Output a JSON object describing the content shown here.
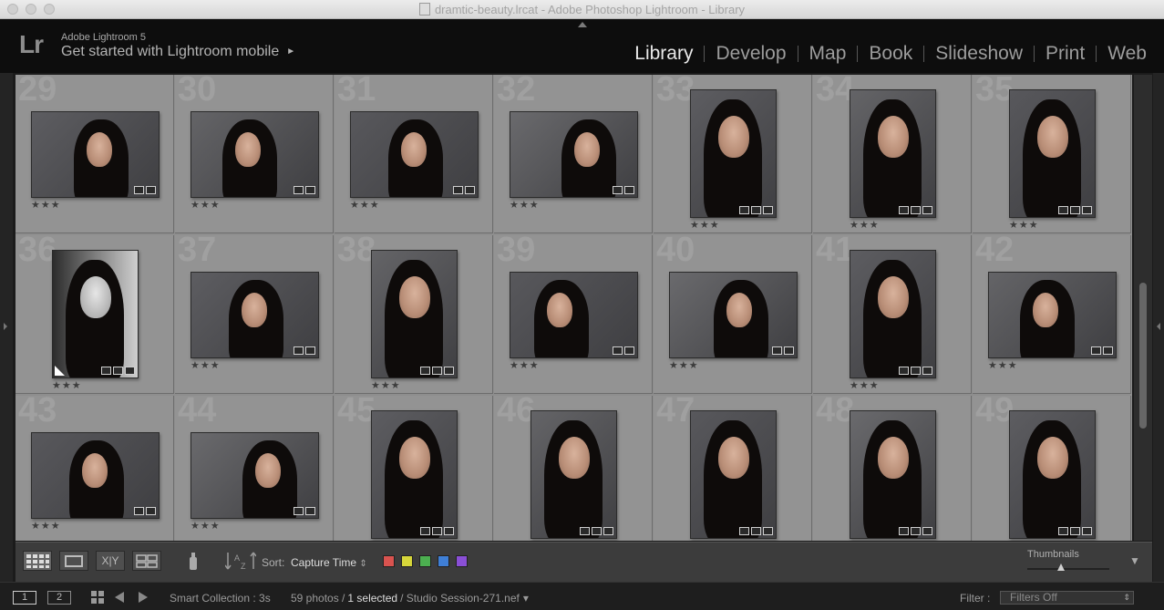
{
  "window": {
    "title": "dramtic-beauty.lrcat - Adobe Photoshop Lightroom - Library"
  },
  "identity": {
    "logo": "Lr",
    "version": "Adobe Lightroom 5",
    "mobile_prompt": "Get started with Lightroom mobile",
    "mobile_arrow": "►"
  },
  "modules": [
    {
      "label": "Library",
      "active": true
    },
    {
      "label": "Develop",
      "active": false
    },
    {
      "label": "Map",
      "active": false
    },
    {
      "label": "Book",
      "active": false
    },
    {
      "label": "Slideshow",
      "active": false
    },
    {
      "label": "Print",
      "active": false
    },
    {
      "label": "Web",
      "active": false
    }
  ],
  "grid": {
    "cells": [
      {
        "num": "29",
        "orient": "l",
        "rating": "★★★"
      },
      {
        "num": "30",
        "orient": "l",
        "rating": "★★★"
      },
      {
        "num": "31",
        "orient": "l",
        "rating": "★★★"
      },
      {
        "num": "32",
        "orient": "l",
        "rating": "★★★"
      },
      {
        "num": "33",
        "orient": "p",
        "rating": "★★★"
      },
      {
        "num": "34",
        "orient": "p",
        "rating": "★★★"
      },
      {
        "num": "35",
        "orient": "p",
        "rating": "★★★"
      },
      {
        "num": "36",
        "orient": "p",
        "rating": "★★★",
        "bw": true,
        "edited": true
      },
      {
        "num": "37",
        "orient": "l",
        "rating": "★★★"
      },
      {
        "num": "38",
        "orient": "p",
        "rating": "★★★"
      },
      {
        "num": "39",
        "orient": "l",
        "rating": "★★★"
      },
      {
        "num": "40",
        "orient": "l",
        "rating": "★★★"
      },
      {
        "num": "41",
        "orient": "p",
        "rating": "★★★"
      },
      {
        "num": "42",
        "orient": "l",
        "rating": "★★★"
      },
      {
        "num": "43",
        "orient": "l",
        "rating": "★★★"
      },
      {
        "num": "44",
        "orient": "l",
        "rating": "★★★"
      },
      {
        "num": "45",
        "orient": "p",
        "rating": ""
      },
      {
        "num": "46",
        "orient": "p",
        "rating": ""
      },
      {
        "num": "47",
        "orient": "p",
        "rating": ""
      },
      {
        "num": "48",
        "orient": "p",
        "rating": ""
      },
      {
        "num": "49",
        "orient": "p",
        "rating": ""
      }
    ]
  },
  "toolbar": {
    "sort_label": "Sort:",
    "sort_value": "Capture Time",
    "sort_arrow": "⇕",
    "xy_label": "X|Y",
    "az_label": "AZ",
    "color_labels": [
      "#d9534f",
      "#d6d63a",
      "#4caf50",
      "#3f7fd6",
      "#8a4fd6"
    ],
    "thumbnails_label": "Thumbnails",
    "collapse_arrow": "▼"
  },
  "filmstrip": {
    "monitor1": "1",
    "monitor2": "2",
    "source": "Smart Collection : 3s",
    "count": "59 photos /",
    "selected": "1 selected",
    "file": "/ Studio Session-271.nef",
    "file_arrow": "▾",
    "filter_label": "Filter :",
    "filter_value": "Filters Off"
  },
  "colors": {
    "accent": "#e8e8e8",
    "grid_bg": "#939393",
    "panel": "#0d0d0d"
  }
}
